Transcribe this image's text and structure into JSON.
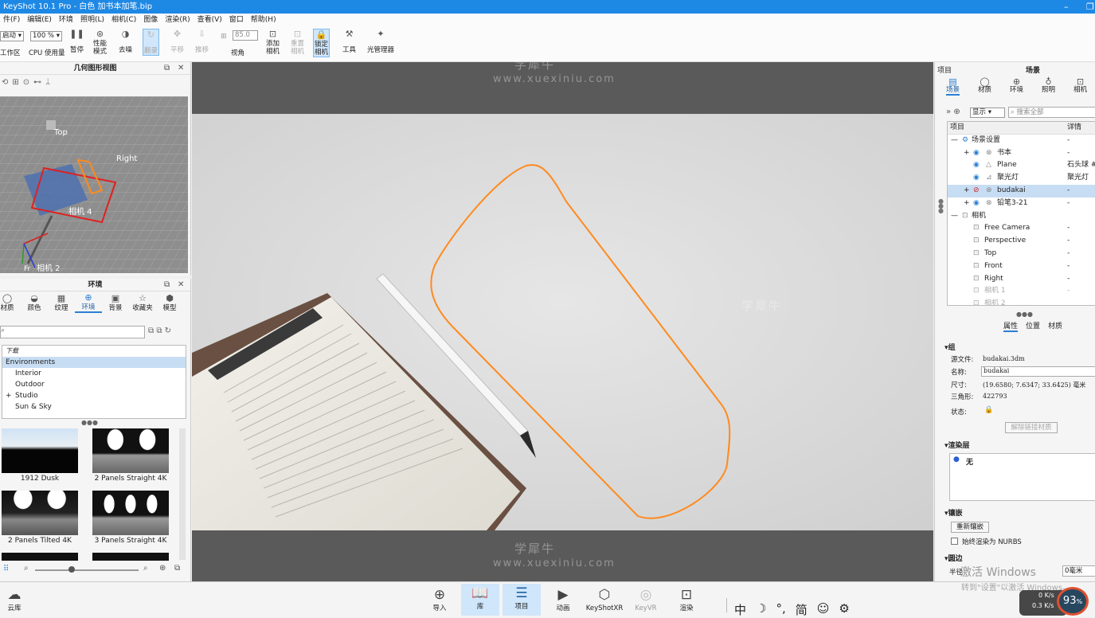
{
  "titlebar": {
    "title": "KeyShot 10.1 Pro  - 白色 加书本加笔.bip",
    "min": "–",
    "close": "❐"
  },
  "menu": [
    "件(F)",
    "编辑(E)",
    "环境",
    "照明(L)",
    "相机(C)",
    "图像",
    "渲染(R)",
    "查看(V)",
    "窗口",
    "帮助(H)"
  ],
  "toolbar": {
    "workspace_select": "启动",
    "workspace_label": "工作区",
    "cpu_select": "100 %",
    "cpu_label": "CPU 使用量",
    "pause": "暂停",
    "perf_mode": "性能\n模式",
    "denoise": "去噪",
    "refresh": "翻录",
    "pan": "平移",
    "push": "推移",
    "fov_value": "85.0",
    "view": "视角",
    "add_camera": "添加\n相机",
    "reset_camera": "重置\n相机",
    "lock_camera": "锁定\n相机",
    "tools": "工具",
    "light_manager": "光管理器"
  },
  "geo": {
    "title": "几何图形视图",
    "labels": {
      "top": "Top",
      "right": "Right",
      "cam4": "相机 4",
      "cam2": "相机 2",
      "front": "Fr"
    }
  },
  "env": {
    "title": "环境",
    "tabs": [
      "材质",
      "颜色",
      "纹理",
      "环境",
      "背景",
      "收藏夹",
      "模型"
    ],
    "tree": [
      "下载",
      "Environments",
      "Interior",
      "Outdoor",
      "Studio",
      "Sun & Sky"
    ],
    "thumbs": [
      "1912 Dusk",
      "2 Panels Straight 4K",
      "2 Panels Tilted 4K",
      "3 Panels Straight 4K"
    ]
  },
  "right": {
    "project": "项目",
    "scene_title": "场景",
    "tabs": [
      "场景",
      "材质",
      "环境",
      "照明",
      "相机"
    ],
    "display": "显示",
    "search_placeholder": "搜索全部",
    "col_item": "项目",
    "col_detail": "详情",
    "rows": [
      {
        "name": "场景设置",
        "detail": "-"
      },
      {
        "name": "书本",
        "detail": "-"
      },
      {
        "name": "Plane",
        "detail": "石头球 #"
      },
      {
        "name": "聚光灯",
        "detail": "聚光灯"
      },
      {
        "name": "budakai",
        "detail": "-"
      },
      {
        "name": "铅笔3-21",
        "detail": "-"
      },
      {
        "name": "相机",
        "detail": ""
      },
      {
        "name": "Free Camera",
        "detail": "-"
      },
      {
        "name": "Perspective",
        "detail": "-"
      },
      {
        "name": "Top",
        "detail": "-"
      },
      {
        "name": "Front",
        "detail": "-"
      },
      {
        "name": "Right",
        "detail": "-"
      },
      {
        "name": "相机 1",
        "detail": "-"
      },
      {
        "name": "相机 2",
        "detail": ""
      }
    ],
    "subtabs": [
      "属性",
      "位置",
      "材质"
    ],
    "group": "组",
    "source_label": "源文件:",
    "source_value": "budakai.3dm",
    "name_label": "名称:",
    "name_value": "budakai",
    "size_label": "尺寸:",
    "size_value": "(19.6580; 7.6347; 33.6425) 毫米",
    "tri_label": "三角形:",
    "tri_value": "422793",
    "state_label": "状态:",
    "unlink": "解除链接材质",
    "render_layer": "渲染层",
    "layer_none": "无",
    "tessellation": "镶嵌",
    "retessellate": "重新镶嵌",
    "nurbs": "始终渲染为 NURBS",
    "rounding": "圆边",
    "radius_label": "半径",
    "radius_value": "0毫米"
  },
  "bottom": {
    "cloud": "云库",
    "buttons": [
      "导入",
      "库",
      "项目",
      "动画",
      "KeyShotXR",
      "KeyVR",
      "渲染"
    ],
    "ime": [
      "中",
      "☽",
      "°,",
      "简",
      "☺",
      "⚙"
    ],
    "net_up": "0 K/s",
    "net_down": "0.3 K/s",
    "percent": "93",
    "activate1": "激活 Windows",
    "activate2": "转到\"设置\"以激活 Windows。"
  },
  "watermark": {
    "cn": "学犀牛",
    "en": "www.xuexiniu.com"
  }
}
